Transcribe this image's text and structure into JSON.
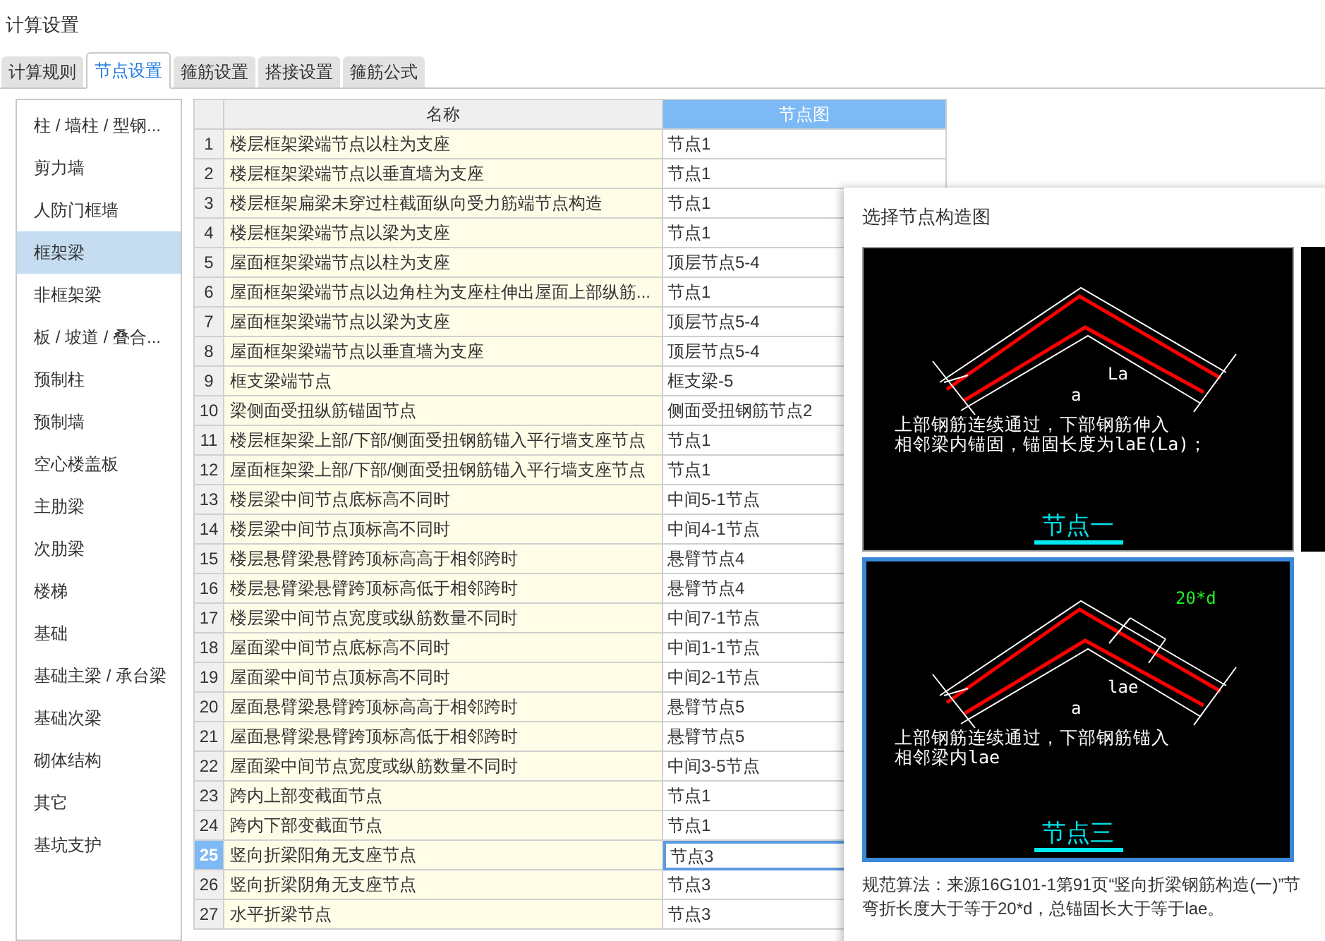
{
  "window": {
    "title": "计算设置"
  },
  "tabs": [
    {
      "label": "计算规则",
      "selected": false
    },
    {
      "label": "节点设置",
      "selected": true
    },
    {
      "label": "箍筋设置",
      "selected": false
    },
    {
      "label": "搭接设置",
      "selected": false
    },
    {
      "label": "箍筋公式",
      "selected": false
    }
  ],
  "sidebar": {
    "items": [
      {
        "label": "柱 / 墙柱 / 型钢...",
        "selected": false
      },
      {
        "label": "剪力墙",
        "selected": false
      },
      {
        "label": "人防门框墙",
        "selected": false
      },
      {
        "label": "框架梁",
        "selected": true
      },
      {
        "label": "非框架梁",
        "selected": false
      },
      {
        "label": "板 / 坡道 / 叠合...",
        "selected": false
      },
      {
        "label": "预制柱",
        "selected": false
      },
      {
        "label": "预制墙",
        "selected": false
      },
      {
        "label": "空心楼盖板",
        "selected": false
      },
      {
        "label": "主肋梁",
        "selected": false
      },
      {
        "label": "次肋梁",
        "selected": false
      },
      {
        "label": "楼梯",
        "selected": false
      },
      {
        "label": "基础",
        "selected": false
      },
      {
        "label": "基础主梁 / 承台梁",
        "selected": false
      },
      {
        "label": "基础次梁",
        "selected": false
      },
      {
        "label": "砌体结构",
        "selected": false
      },
      {
        "label": "其它",
        "selected": false
      },
      {
        "label": "基坑支护",
        "selected": false
      }
    ]
  },
  "table": {
    "columns": [
      "名称",
      "节点图"
    ],
    "rows": [
      {
        "no": "1",
        "name": "楼层框架梁端节点以柱为支座",
        "node": "节点1",
        "selected": false
      },
      {
        "no": "2",
        "name": "楼层框架梁端节点以垂直墙为支座",
        "node": "节点1",
        "selected": false
      },
      {
        "no": "3",
        "name": "楼层框架扁梁未穿过柱截面纵向受力筋端节点构造",
        "node": "节点1",
        "selected": false
      },
      {
        "no": "4",
        "name": "楼层框架梁端节点以梁为支座",
        "node": "节点1",
        "selected": false
      },
      {
        "no": "5",
        "name": "屋面框架梁端节点以柱为支座",
        "node": "顶层节点5-4",
        "selected": false
      },
      {
        "no": "6",
        "name": "屋面框架梁端节点以边角柱为支座柱伸出屋面上部纵筋...",
        "node": "节点1",
        "selected": false
      },
      {
        "no": "7",
        "name": "屋面框架梁端节点以梁为支座",
        "node": "顶层节点5-4",
        "selected": false
      },
      {
        "no": "8",
        "name": "屋面框架梁端节点以垂直墙为支座",
        "node": "顶层节点5-4",
        "selected": false
      },
      {
        "no": "9",
        "name": "框支梁端节点",
        "node": "框支梁-5",
        "selected": false
      },
      {
        "no": "10",
        "name": "梁侧面受扭纵筋锚固节点",
        "node": "侧面受扭钢筋节点2",
        "selected": false
      },
      {
        "no": "11",
        "name": "楼层框架梁上部/下部/侧面受扭钢筋锚入平行墙支座节点",
        "node": "节点1",
        "selected": false
      },
      {
        "no": "12",
        "name": "屋面框架梁上部/下部/侧面受扭钢筋锚入平行墙支座节点",
        "node": "节点1",
        "selected": false
      },
      {
        "no": "13",
        "name": "楼层梁中间节点底标高不同时",
        "node": "中间5-1节点",
        "selected": false
      },
      {
        "no": "14",
        "name": "楼层梁中间节点顶标高不同时",
        "node": "中间4-1节点",
        "selected": false
      },
      {
        "no": "15",
        "name": "楼层悬臂梁悬臂跨顶标高高于相邻跨时",
        "node": "悬臂节点4",
        "selected": false
      },
      {
        "no": "16",
        "name": "楼层悬臂梁悬臂跨顶标高低于相邻跨时",
        "node": "悬臂节点4",
        "selected": false
      },
      {
        "no": "17",
        "name": "楼层梁中间节点宽度或纵筋数量不同时",
        "node": "中间7-1节点",
        "selected": false
      },
      {
        "no": "18",
        "name": "屋面梁中间节点底标高不同时",
        "node": "中间1-1节点",
        "selected": false
      },
      {
        "no": "19",
        "name": "屋面梁中间节点顶标高不同时",
        "node": "中间2-1节点",
        "selected": false
      },
      {
        "no": "20",
        "name": "屋面悬臂梁悬臂跨顶标高高于相邻跨时",
        "node": "悬臂节点5",
        "selected": false
      },
      {
        "no": "21",
        "name": "屋面悬臂梁悬臂跨顶标高低于相邻跨时",
        "node": "悬臂节点5",
        "selected": false
      },
      {
        "no": "22",
        "name": "屋面梁中间节点宽度或纵筋数量不同时",
        "node": "中间3-5节点",
        "selected": false
      },
      {
        "no": "23",
        "name": "跨内上部变截面节点",
        "node": "节点1",
        "selected": false
      },
      {
        "no": "24",
        "name": "跨内下部变截面节点",
        "node": "节点1",
        "selected": false
      },
      {
        "no": "25",
        "name": "竖向折梁阳角无支座节点",
        "node": "节点3",
        "selected": true
      },
      {
        "no": "26",
        "name": "竖向折梁阴角无支座节点",
        "node": "节点3",
        "selected": false
      },
      {
        "no": "27",
        "name": "水平折梁节点",
        "node": "节点3",
        "selected": false
      }
    ]
  },
  "popup": {
    "title": "选择节点构造图",
    "options": [
      {
        "labels": [
          "La",
          "a"
        ],
        "note": [
          "上部钢筋连续通过，下部钢筋伸入",
          "相邻梁内锚固，锚固长度为laE(La)；"
        ],
        "caption": "节点一",
        "selected": false
      },
      {
        "labels": [
          "20*d",
          "lae",
          "a"
        ],
        "note": [
          "上部钢筋连续通过，下部钢筋锚入",
          "相邻梁内lae"
        ],
        "caption": "节点三",
        "selected": true
      }
    ],
    "description": [
      "规范算法：来源16G101-1第91页“竖向折梁钢筋构造(一)”节",
      "弯折长度大于等于20*d，总锚固长大于等于lae。"
    ]
  }
}
